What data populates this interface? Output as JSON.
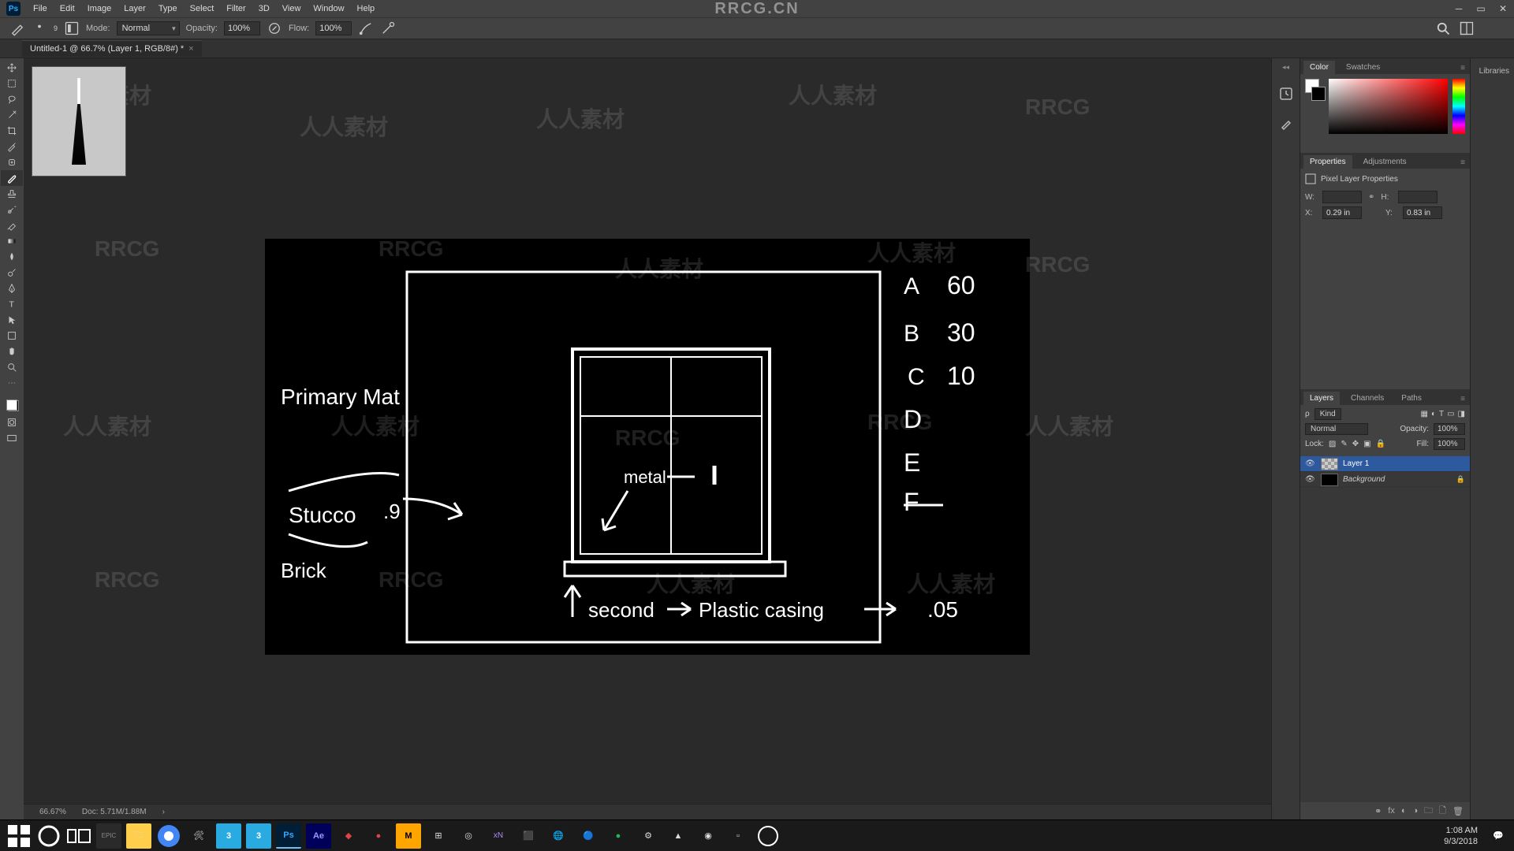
{
  "menubar": [
    "File",
    "Edit",
    "Image",
    "Layer",
    "Type",
    "Select",
    "Filter",
    "3D",
    "View",
    "Window",
    "Help"
  ],
  "watermark_center": "RRCG.CN",
  "options": {
    "brush_size": "9",
    "mode_label": "Mode:",
    "mode_value": "Normal",
    "opacity_label": "Opacity:",
    "opacity_value": "100%",
    "flow_label": "Flow:",
    "flow_value": "100%"
  },
  "doc_tab": "Untitled-1 @ 66.7% (Layer 1, RGB/8#) *",
  "status": {
    "zoom": "66.67%",
    "doc": "Doc: 5.71M/1.88M"
  },
  "panels": {
    "color_tab": "Color",
    "swatches_tab": "Swatches",
    "libraries_tab": "Libraries",
    "properties_tab": "Properties",
    "adjustments_tab": "Adjustments",
    "props_header": "Pixel Layer Properties",
    "props": {
      "W_label": "W:",
      "W_value": "",
      "H_label": "H:",
      "H_value": "",
      "X_label": "X:",
      "X_value": "0.29 in",
      "Y_label": "Y:",
      "Y_value": "0.83 in"
    },
    "layers_tab": "Layers",
    "channels_tab": "Channels",
    "paths_tab": "Paths",
    "layers_opts": {
      "kind_label": "Kind",
      "blend_mode": "Normal",
      "opacity_label": "Opacity:",
      "opacity_value": "100%",
      "lock_label": "Lock:",
      "fill_label": "Fill:",
      "fill_value": "100%"
    },
    "layers": [
      {
        "name": "Layer 1",
        "selected": true,
        "locked": false
      },
      {
        "name": "Background",
        "selected": false,
        "locked": true
      }
    ]
  },
  "taskbar": {
    "time": "1:08 AM",
    "date": "9/3/2018"
  },
  "canvas_text": {
    "primary": "Primary Mat",
    "stucco": "Stucco",
    "stucco_val": ".9",
    "brick": "Brick",
    "metal": "metal",
    "second": "second",
    "plastic": "Plastic casing",
    "plastic_val": ".05",
    "A": "A",
    "A_val": "60",
    "B": "B",
    "B_val": "30",
    "C": "C",
    "C_val": "10",
    "D": "D",
    "E": "E",
    "F": "F"
  }
}
